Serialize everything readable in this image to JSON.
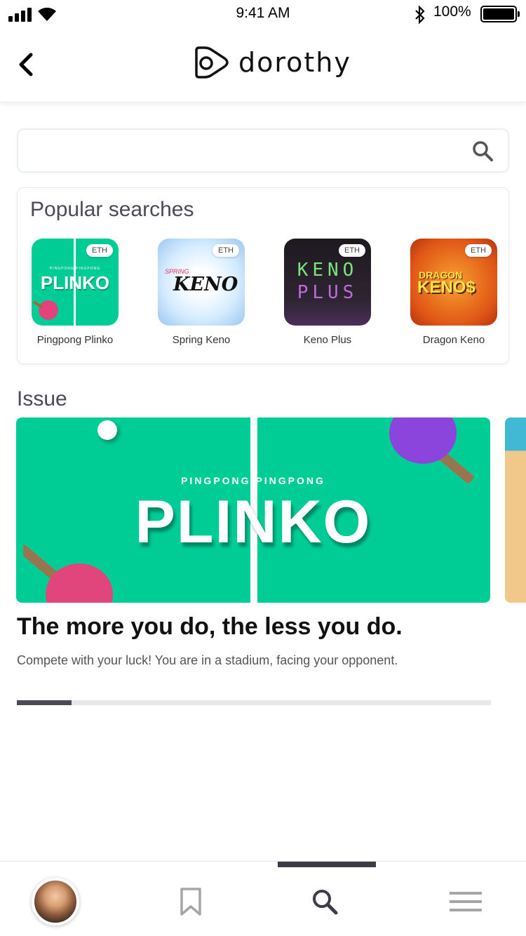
{
  "status_bar": {
    "time": "9:41 AM",
    "battery_percent": "100%"
  },
  "header": {
    "brand_name": "dorothy",
    "back_icon": "chevron-left-icon",
    "logo_icon": "play-logo-icon"
  },
  "search": {
    "value": "",
    "placeholder": "",
    "icon": "search-icon"
  },
  "popular": {
    "title": "Popular searches",
    "games": [
      {
        "label": "Pingpong Plinko",
        "badge": "ETH",
        "art_top": "PINGPONG PINGPONG",
        "art_word": "PLINKO"
      },
      {
        "label": "Spring Keno",
        "badge": "ETH",
        "art_tag": "SPRING",
        "art_word": "KENO"
      },
      {
        "label": "Keno Plus",
        "badge": "ETH",
        "art_line1": "KENO",
        "art_line2": "PLUS"
      },
      {
        "label": "Dragon Keno",
        "badge": "ETH",
        "art_line1": "DRAGON",
        "art_line2": "KENO$"
      }
    ]
  },
  "issue": {
    "title": "Issue",
    "banner_top": "PINGPONG PINGPONG",
    "banner_word": "PLINKO",
    "headline": "The more you do, the less you do.",
    "description": "Compete with your luck! You are in a stadium, facing your opponent.",
    "progress": 0.115
  },
  "tabbar": {
    "tabs": [
      {
        "name": "profile",
        "icon": "avatar"
      },
      {
        "name": "bookmarks",
        "icon": "bookmark-icon"
      },
      {
        "name": "search",
        "icon": "search-icon",
        "active": true
      },
      {
        "name": "menu",
        "icon": "menu-icon"
      }
    ]
  },
  "colors": {
    "accent_green": "#00cd96",
    "text_dark": "#4b4a57",
    "indicator": "#3c3b47"
  }
}
